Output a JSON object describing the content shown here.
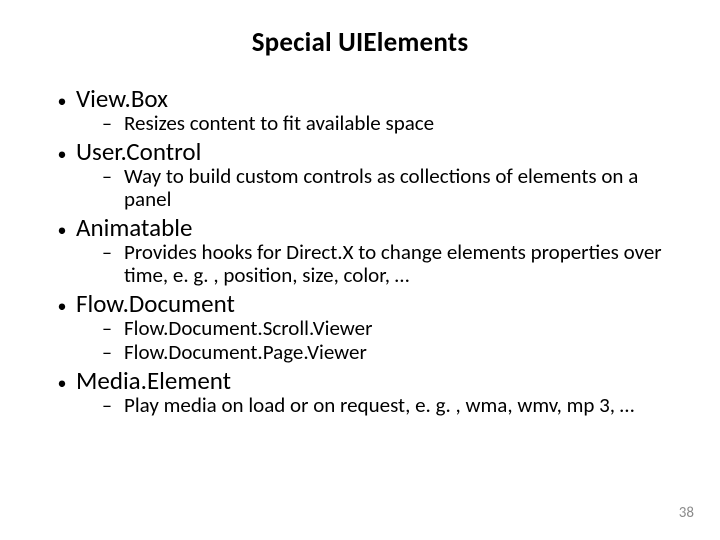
{
  "title": "Special UIElements",
  "items": [
    {
      "label": "View.Box",
      "subs": [
        "Resizes content to fit available space"
      ]
    },
    {
      "label": "User.Control",
      "subs": [
        "Way to build custom controls as collections of elements on a panel"
      ]
    },
    {
      "label": "Animatable",
      "subs": [
        "Provides hooks for Direct.X to change elements properties over time, e. g. , position, size, color, …"
      ]
    },
    {
      "label": "Flow.Document",
      "subs": [
        "Flow.Document.Scroll.Viewer",
        "Flow.Document.Page.Viewer"
      ]
    },
    {
      "label": "Media.Element",
      "subs": [
        "Play media on load or on request, e. g. , wma, wmv, mp 3, …"
      ]
    }
  ],
  "page_number": "38"
}
